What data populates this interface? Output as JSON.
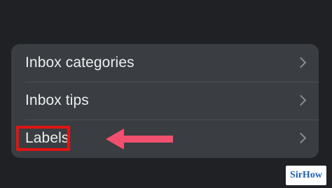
{
  "settings": {
    "rows": [
      {
        "label": "Inbox categories"
      },
      {
        "label": "Inbox tips"
      },
      {
        "label": "Labels"
      }
    ]
  },
  "annotation": {
    "highlight_color": "#e01414",
    "arrow_color": "#f0506e"
  },
  "watermark": {
    "text": "SirHow",
    "text_color": "#1d5fb8"
  },
  "icons": {
    "row_chevron": "chevron-right-icon"
  },
  "colors": {
    "background": "#1f2124",
    "card": "#3a3d41",
    "text": "#eceef0",
    "chevron": "#8a8d92"
  }
}
